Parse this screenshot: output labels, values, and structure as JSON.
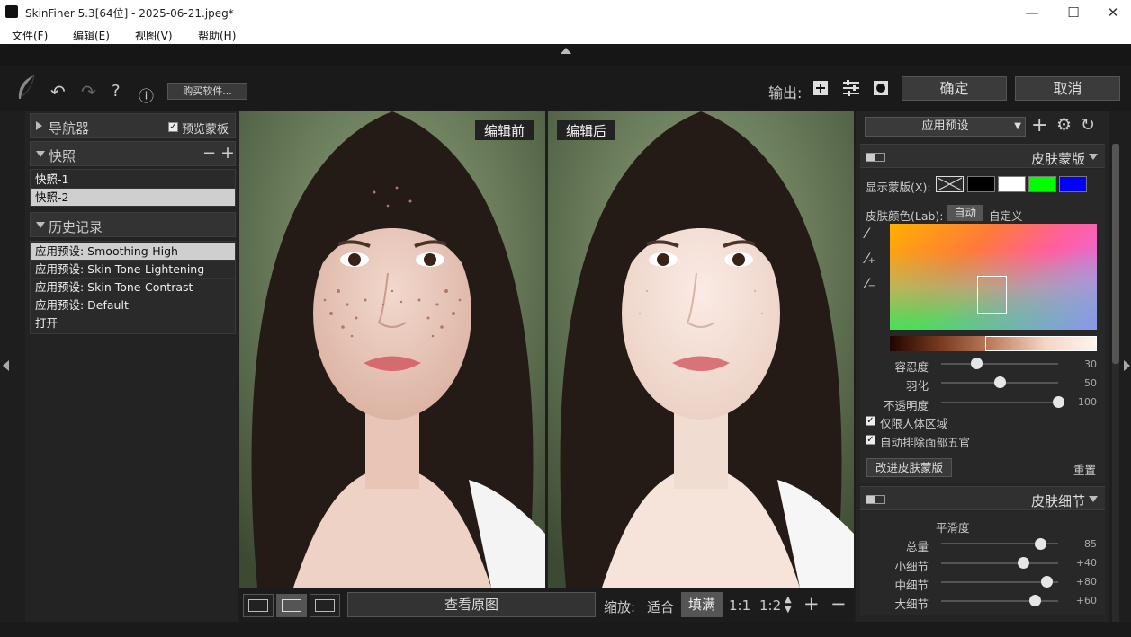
{
  "window": {
    "title": "SkinFiner 5.3[64位] - 2025-06-21.jpeg*",
    "minimize": "—",
    "maximize": "☐",
    "close": "✕"
  },
  "menu": [
    "文件(F)",
    "编辑(E)",
    "视图(V)",
    "帮助(H)"
  ],
  "toolbar": {
    "buy_label": "购买软件...",
    "output_label": "输出:",
    "ok_label": "确定",
    "cancel_label": "取消"
  },
  "navigator": {
    "label": "导航器",
    "preview_mask_label": "预览蒙板",
    "preview_mask_checked": true
  },
  "snapshots": {
    "label": "快照",
    "items": [
      "快照-1",
      "快照-2"
    ],
    "selected": 1
  },
  "history": {
    "label": "历史记录",
    "items": [
      "应用预设: Smoothing-High",
      "应用预设: Skin Tone-Lightening",
      "应用预设: Skin Tone-Contrast",
      "应用预设: Default",
      "打开"
    ],
    "selected": 0
  },
  "preview": {
    "before_label": "编辑前",
    "after_label": "编辑后"
  },
  "viewbar": {
    "original_label": "查看原图",
    "zoom_label": "缩放:",
    "fit_label": "适合",
    "fill_label": "填满",
    "one_to_one": "1:1",
    "one_to_two": "1:2"
  },
  "right": {
    "preset_label": "应用预设",
    "skin_mask": {
      "label": "皮肤蒙版",
      "show_mask_label": "显示蒙版(X):",
      "swatch_colors": [
        "#000000",
        "#ffffff",
        "#00ff00",
        "#0000ff"
      ],
      "skin_color_label": "皮肤颜色(Lab):",
      "auto_label": "自动",
      "custom_label": "自定义",
      "sliders": [
        {
          "label": "容忍度",
          "value": 30,
          "min": 0,
          "max": 100
        },
        {
          "label": "羽化",
          "value": 50,
          "min": 0,
          "max": 100
        },
        {
          "label": "不透明度",
          "value": 100,
          "min": 0,
          "max": 100
        }
      ],
      "checks": [
        {
          "label": "仅限人体区域",
          "checked": true
        },
        {
          "label": "自动排除面部五官",
          "checked": true
        }
      ],
      "improve_label": "改进皮肤蒙版",
      "reset_label": "重置"
    },
    "skin_detail": {
      "label": "皮肤细节",
      "smoothness_label": "平滑度",
      "sliders": [
        {
          "label": "总量",
          "value": "85",
          "pos": 0.85
        },
        {
          "label": "小细节",
          "value": "+40",
          "pos": 0.7
        },
        {
          "label": "中细节",
          "value": "+80",
          "pos": 0.9
        },
        {
          "label": "大细节",
          "value": "+60",
          "pos": 0.8
        }
      ]
    }
  }
}
